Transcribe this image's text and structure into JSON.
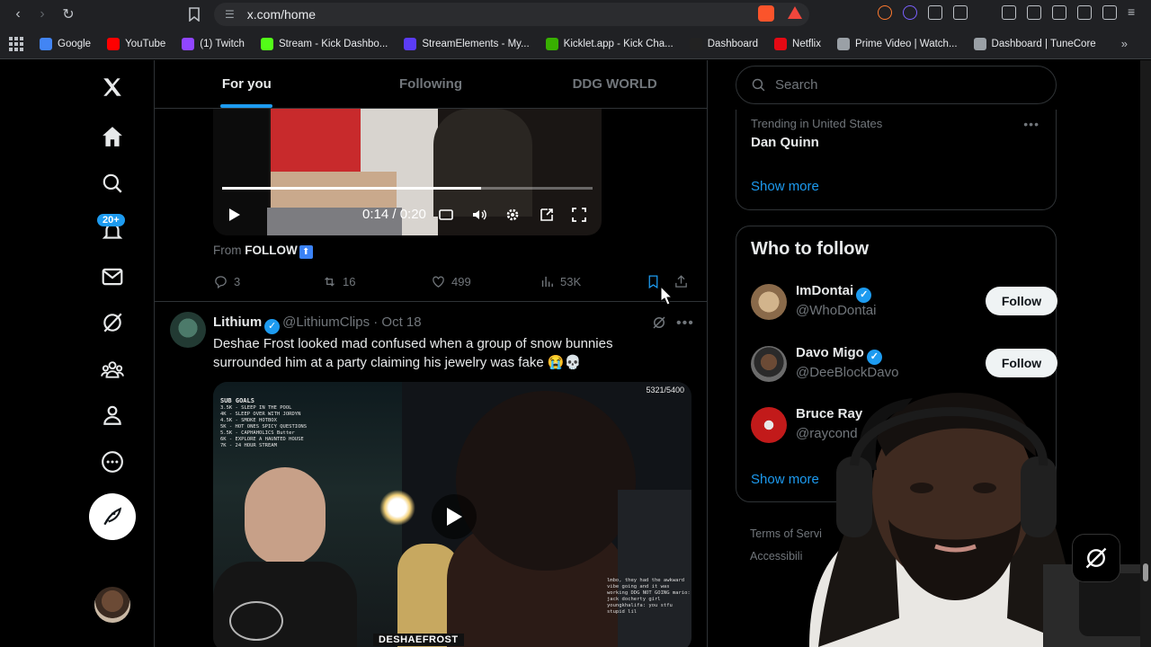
{
  "browser": {
    "url": "x.com/home",
    "bookmarks": [
      {
        "label": "Google",
        "color": "#4285f4"
      },
      {
        "label": "YouTube",
        "color": "#ff0000"
      },
      {
        "label": "(1) Twitch",
        "color": "#9146ff"
      },
      {
        "label": "Stream - Kick Dashbo...",
        "color": "#53fc18"
      },
      {
        "label": "StreamElements - My...",
        "color": "#5b3cf5"
      },
      {
        "label": "Kicklet.app - Kick Cha...",
        "color": "#38b000"
      },
      {
        "label": "Dashboard",
        "color": "#222222"
      },
      {
        "label": "Netflix",
        "color": "#e50914"
      },
      {
        "label": "Prime Video | Watch...",
        "color": "#9aa0a6"
      },
      {
        "label": "Dashboard | TuneCore",
        "color": "#9aa0a6"
      }
    ]
  },
  "nav": {
    "notif_badge": "20+",
    "icons": [
      "x-logo-icon",
      "home-icon",
      "search-icon",
      "bell-icon",
      "mail-icon",
      "grok-icon",
      "communities-icon",
      "profile-icon",
      "more-icon"
    ]
  },
  "tabs": [
    {
      "label": "For you",
      "active": true
    },
    {
      "label": "Following",
      "active": false
    },
    {
      "label": "DDG WORLD",
      "active": false
    }
  ],
  "tweet1": {
    "video_time": "0:14 / 0:20",
    "video_progress": 0.7,
    "from_prefix": "From",
    "from_name": "FOLLOW",
    "replies": "3",
    "reposts": "16",
    "likes": "499",
    "views": "53K"
  },
  "tweet2": {
    "name": "Lithium",
    "handle": "@LithiumClips",
    "date": "· Oct 18",
    "text": "Deshae Frost looked mad confused when a group of snow bunnies surrounded him at a party claiming his jewelry was fake 😭💀",
    "video_counter": "5321/5400",
    "video_goals_title": "SUB GOALS",
    "video_goals": "3.5K - SLEEP IN THE POOL\n4K - SLEEP OVER WITH JORDYN\n4.5K - SMOKE HOTBOX\n5K - HOT ONES SPICY QUESTIONS\n5.5K - CAPHAHOLICS Butter\n6K - EXPLORE A HAUNTED HOUSE\n7K - 24 HOUR STREAM",
    "video_brand": "DESHAEFROST",
    "video_chat": "lmbo, they had the awkward vibe going and it was working\nDDG NOT GOING\nmario: jack docherty girl\nyoungkhalifa: you stfu stupid lil"
  },
  "sidebar": {
    "search_placeholder": "Search",
    "trend_meta": "Trending in United States",
    "trend_name": "Dan Quinn",
    "show_more": "Show more",
    "who_to_follow": "Who to follow",
    "follow_label": "Follow",
    "accounts": [
      {
        "name": "ImDontai",
        "handle": "@WhoDontai",
        "verified": true
      },
      {
        "name": "Davo Migo",
        "handle": "@DeeBlockDavo",
        "verified": true
      },
      {
        "name": "Bruce Ray",
        "handle": "@raycond",
        "verified": false
      }
    ],
    "footer1": "Terms of Servi",
    "footer2": "Accessibili"
  }
}
